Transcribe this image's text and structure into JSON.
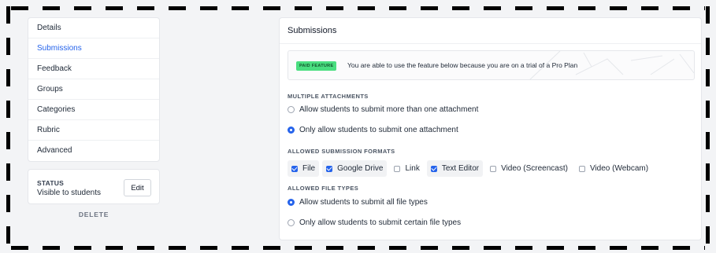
{
  "sidebar": {
    "items": [
      {
        "label": "Details",
        "active": false
      },
      {
        "label": "Submissions",
        "active": true
      },
      {
        "label": "Feedback",
        "active": false
      },
      {
        "label": "Groups",
        "active": false
      },
      {
        "label": "Categories",
        "active": false
      },
      {
        "label": "Rubric",
        "active": false
      },
      {
        "label": "Advanced",
        "active": false
      }
    ]
  },
  "status": {
    "label": "STATUS",
    "value": "Visible to students",
    "edit_label": "Edit"
  },
  "delete_label": "DELETE",
  "main": {
    "title": "Submissions",
    "paid_banner": {
      "badge": "PAID FEATURE",
      "text": "You are able to use the feature below because you are on a trial of a Pro Plan"
    },
    "multiple_attachments": {
      "label": "MULTIPLE ATTACHMENTS",
      "options": [
        {
          "label": "Allow students to submit more than one attachment",
          "selected": false
        },
        {
          "label": "Only allow students to submit one attachment",
          "selected": true
        }
      ]
    },
    "formats": {
      "label": "ALLOWED SUBMISSION FORMATS",
      "options": [
        {
          "label": "File",
          "checked": true
        },
        {
          "label": "Google Drive",
          "checked": true
        },
        {
          "label": "Link",
          "checked": false
        },
        {
          "label": "Text Editor",
          "checked": true
        },
        {
          "label": "Video (Screencast)",
          "checked": false
        },
        {
          "label": "Video (Webcam)",
          "checked": false
        }
      ]
    },
    "file_types": {
      "label": "ALLOWED FILE TYPES",
      "options": [
        {
          "label": "Allow students to submit all file types",
          "selected": true
        },
        {
          "label": "Only allow students to submit certain file types",
          "selected": false
        }
      ]
    }
  },
  "colors": {
    "accent": "#2563eb",
    "paid_badge": "#4ade80"
  }
}
